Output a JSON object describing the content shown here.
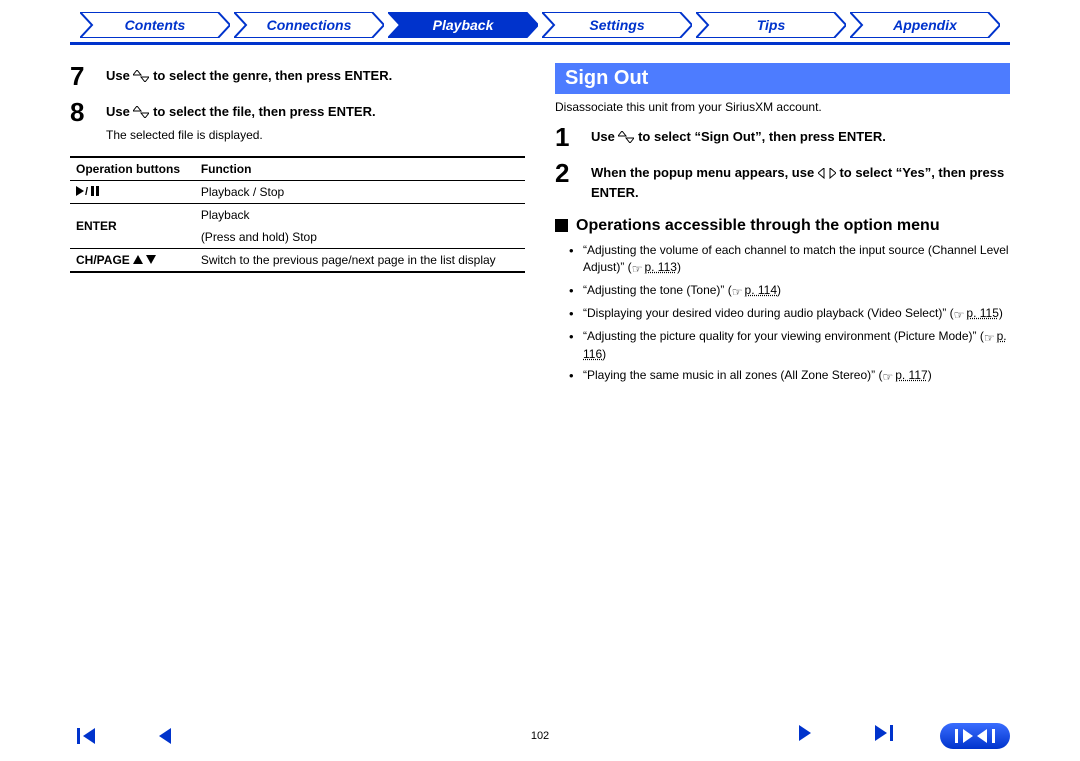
{
  "tabs": {
    "contents": "Contents",
    "connections": "Connections",
    "playback": "Playback",
    "settings": "Settings",
    "tips": "Tips",
    "appendix": "Appendix"
  },
  "left": {
    "step7": {
      "num": "7",
      "text_a": "Use ",
      "text_b": " to select the genre, then press ENTER."
    },
    "step8": {
      "num": "8",
      "text_a": "Use ",
      "text_b": " to select the file, then press ENTER.",
      "note": "The selected file is displayed."
    },
    "table": {
      "h1": "Operation buttons",
      "h2": "Function",
      "r1c1_glyph": "▶/❚❚",
      "r1c2": "Playback / Stop",
      "r2c1": "ENTER",
      "r2c2a": "Playback",
      "r2c2b": "(Press and hold) Stop",
      "r3c1_a": "CH/PAGE ",
      "r3c2": "Switch to the previous page/next page in the list display"
    }
  },
  "right": {
    "title": "Sign Out",
    "desc": "Disassociate this unit from your SiriusXM account.",
    "step1": {
      "num": "1",
      "text_a": "Use ",
      "text_b": " to select “Sign Out”, then press ENTER."
    },
    "step2": {
      "num": "2",
      "text_a": "When the popup menu appears, use ",
      "text_b": " to select “Yes”, then press ENTER."
    },
    "sub": "Operations accessible through the option menu",
    "opts": {
      "o1a": "“Adjusting the volume of each channel to match the input source (Channel Level Adjust)” (",
      "o1p": "p. 113",
      "o2a": "“Adjusting the tone (Tone)” (",
      "o2p": "p. 114",
      "o3a": "“Displaying your desired video during audio playback (Video Select)” (",
      "o3p": "p. 115",
      "o4a": "“Adjusting the picture quality for your viewing environment (Picture Mode)” (",
      "o4p": "p. 116",
      "o5a": "“Playing the same music in all zones (All Zone Stereo)” (",
      "o5p": "p. 117",
      "close": ")"
    }
  },
  "footer": {
    "page": "102"
  }
}
